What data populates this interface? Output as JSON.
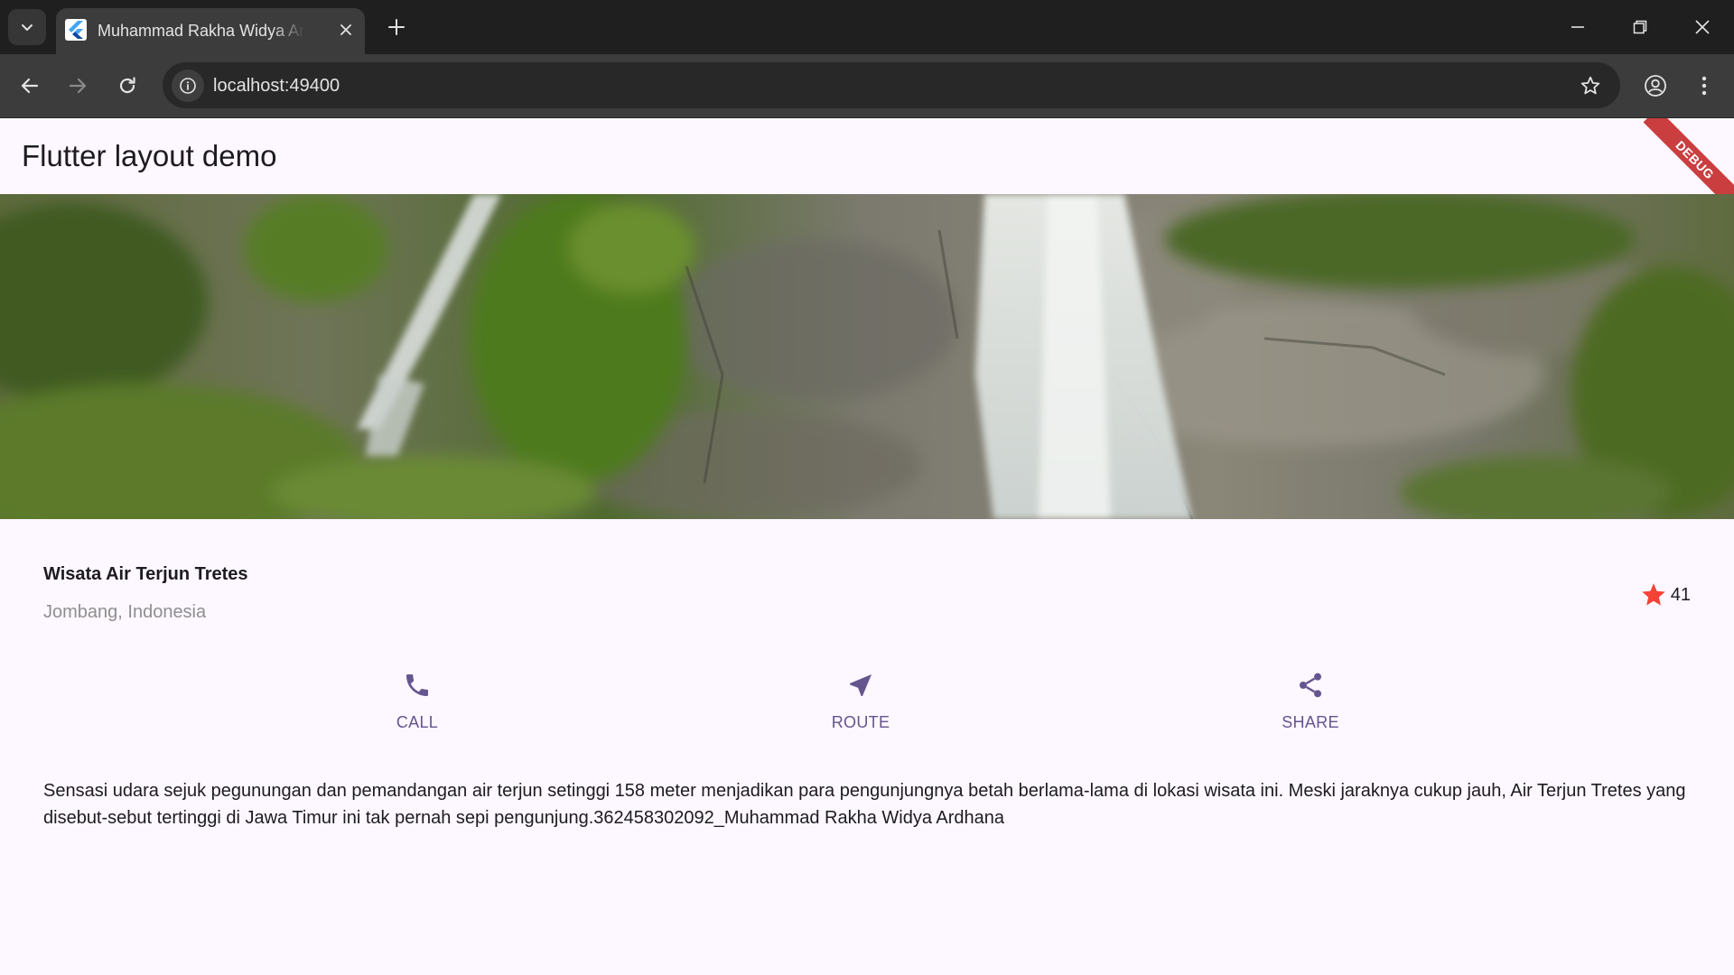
{
  "browser": {
    "tab_title": "Muhammad Rakha Widya Ardhana",
    "url": "localhost:49400"
  },
  "app": {
    "title": "Flutter layout demo",
    "debug_banner": "DEBUG",
    "place": {
      "name": "Wisata Air Terjun Tretes",
      "location": "Jombang, Indonesia",
      "rating_count": "41"
    },
    "actions": [
      {
        "label": "CALL",
        "icon": "phone-icon"
      },
      {
        "label": "ROUTE",
        "icon": "near-me-icon"
      },
      {
        "label": "SHARE",
        "icon": "share-icon"
      }
    ],
    "description": "Sensasi udara sejuk pegunungan dan pemandangan air terjun setinggi 158 meter menjadikan para pengunjungnya betah berlama-lama di lokasi wisata ini. Meski jaraknya cukup jauh, Air Terjun Tretes yang disebut-sebut tertinggi di Jawa Timur ini tak pernah sepi pengunjung.362458302092_Muhammad Rakha Widya Ardhana"
  },
  "colors": {
    "accent": "#65558f",
    "star": "#f44336",
    "background": "#fdf7ff"
  }
}
